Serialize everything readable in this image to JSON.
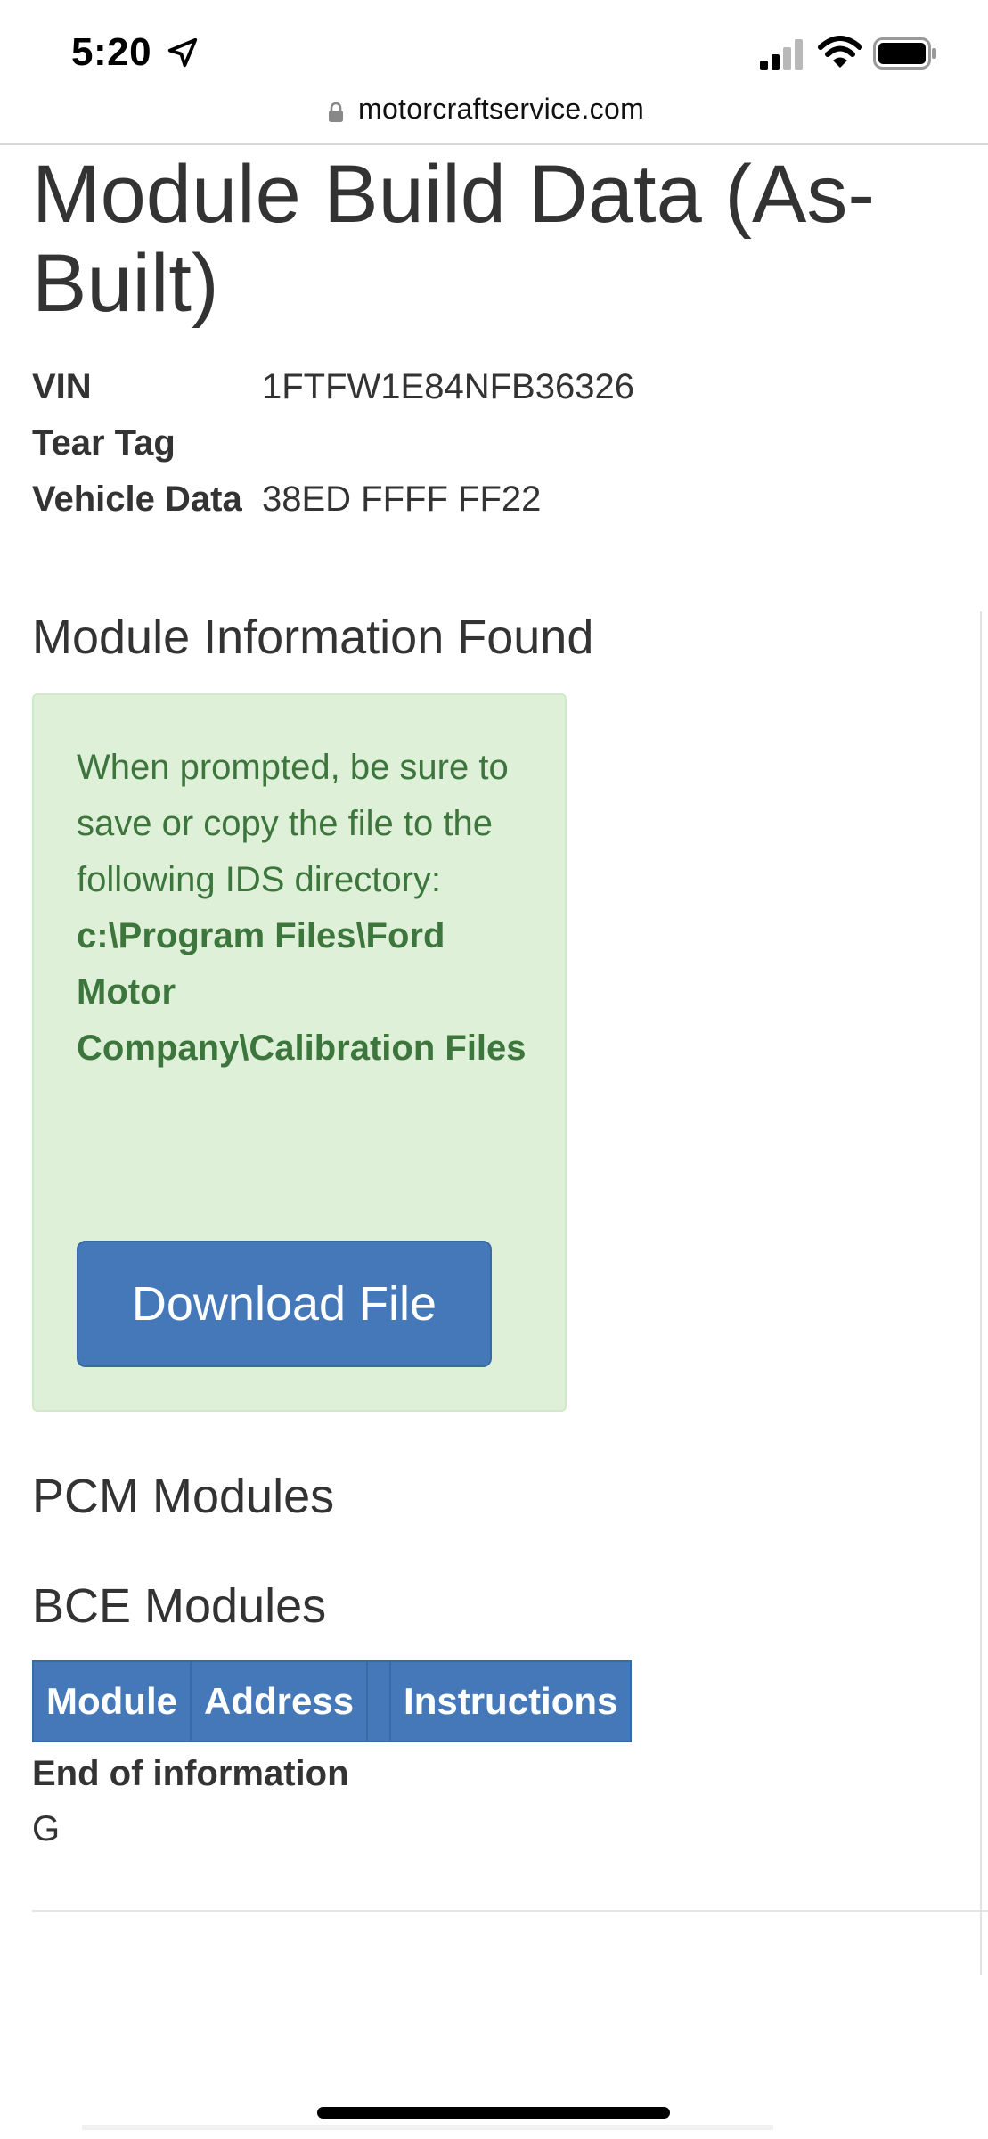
{
  "status_bar": {
    "time": "5:20",
    "location_icon": "location-arrow-icon",
    "signal_icon": "cellular-signal-icon",
    "wifi_icon": "wifi-icon",
    "battery_icon": "battery-icon"
  },
  "browser": {
    "lock_icon": "lock-icon",
    "url": "motorcraftservice.com"
  },
  "page": {
    "title": "Module Build Data (As-Built)",
    "vin_label": "VIN",
    "vin_value": "1FTFW1E84NFB36326",
    "tear_tag_label": "Tear Tag",
    "tear_tag_value": "",
    "vehicle_data_label": "Vehicle Data",
    "vehicle_data_value": "38ED FFFF FF22"
  },
  "module_info": {
    "heading": "Module Information Found",
    "message": "When prompted, be sure to save or copy the file to the following IDS directory:",
    "path": "c:\\Program Files\\Ford Motor Company\\Calibration Files",
    "download_label": "Download File"
  },
  "pcm": {
    "heading": "PCM Modules"
  },
  "bce": {
    "heading": "BCE Modules",
    "columns": [
      "Module",
      "Address",
      "",
      "Instructions"
    ]
  },
  "end": {
    "text": "End of information",
    "letter": "G"
  },
  "colors": {
    "primary_blue": "#4478b8",
    "alert_bg": "#dff0d8",
    "alert_text": "#3c763d"
  }
}
